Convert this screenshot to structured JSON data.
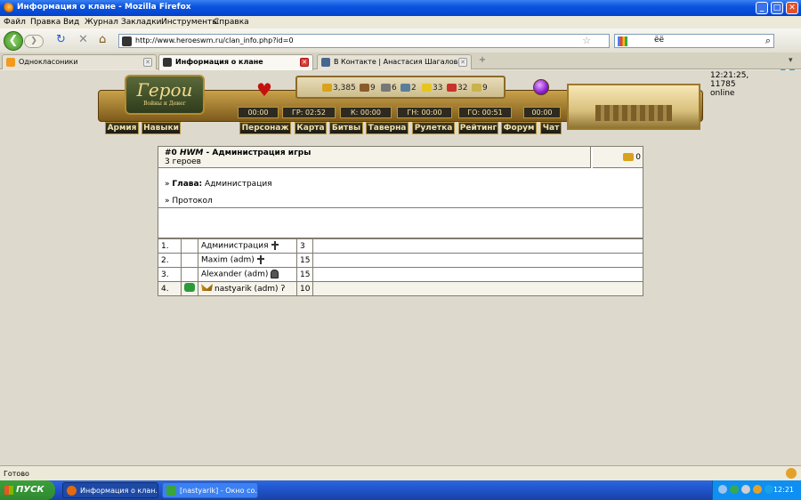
{
  "window": {
    "title": "Информация о клане - Mozilla Firefox",
    "btn_min": "_",
    "btn_max": "□",
    "btn_close": "✕"
  },
  "menu": [
    "Файл",
    "Правка",
    "Вид",
    "Журнал",
    "Закладки",
    "Инструменты",
    "Справка"
  ],
  "nav": {
    "back": "❮",
    "forward": "❯",
    "reload": "↻",
    "stop": "✕",
    "home": "⌂",
    "url": "http://www.heroeswm.ru/clan_info.php?id=0",
    "search_text": "ёё"
  },
  "tabs": [
    {
      "label": "Однокласоники",
      "active": false
    },
    {
      "label": "Информация о клане",
      "active": true
    },
    {
      "label": "В Контакте | Анастасия Шагалова",
      "active": false
    }
  ],
  "game": {
    "logo": "Герои",
    "logo_sub": "Войны и Денег",
    "clock": "12:21:25, 11785 online",
    "resources": [
      {
        "icon": "gold-icon",
        "value": "3,385",
        "color": "#d9a21c"
      },
      {
        "icon": "wood-icon",
        "value": "9",
        "color": "#8b5a2b"
      },
      {
        "icon": "ore-icon",
        "value": "6",
        "color": "#777777"
      },
      {
        "icon": "mercury-icon",
        "value": "2",
        "color": "#5a7d9a"
      },
      {
        "icon": "sulfur-icon",
        "value": "33",
        "color": "#e5c51f"
      },
      {
        "icon": "crystal-icon",
        "value": "32",
        "color": "#c8332a"
      },
      {
        "icon": "gem-icon",
        "value": "9",
        "color": "#c9b34a"
      }
    ],
    "timers": [
      "00:00",
      "ГР: 02:52",
      "К: 00:00",
      "ГН: 00:00",
      "ГО: 00:51",
      "00:00"
    ],
    "left_buttons": [
      "Армия",
      "Навыки"
    ],
    "nav_buttons": [
      "Персонаж",
      "Карта",
      "Битвы",
      "Таверна",
      "Рулетка",
      "Рейтинг",
      "Форум",
      "Чат"
    ]
  },
  "clan": {
    "prefix": "#0",
    "name": "HWM",
    "title_rest": "- Администрация игры",
    "count": "3 героев",
    "gold": "0",
    "head_label": "Глава:",
    "head_name": "Администрация",
    "protocol": "Протокол",
    "members": [
      {
        "num": "1.",
        "name": "Администрация",
        "level": "3",
        "icon": "cross"
      },
      {
        "num": "2.",
        "name": "Maxim (adm)",
        "level": "15",
        "icon": "cross"
      },
      {
        "num": "3.",
        "name": "Alexander (adm)",
        "level": "15",
        "icon": "helm"
      },
      {
        "num": "4.",
        "name": "nastyarik (adm)",
        "level": "10",
        "icon": "scythe"
      }
    ]
  },
  "status": {
    "text": "Готово"
  },
  "taskbar": {
    "start": "ПУСК",
    "tasks": [
      {
        "label": "Информация о клан...",
        "active": true
      },
      {
        "label": "[nastyarik] - Окно со...",
        "active": false
      }
    ],
    "time": "12:21"
  }
}
